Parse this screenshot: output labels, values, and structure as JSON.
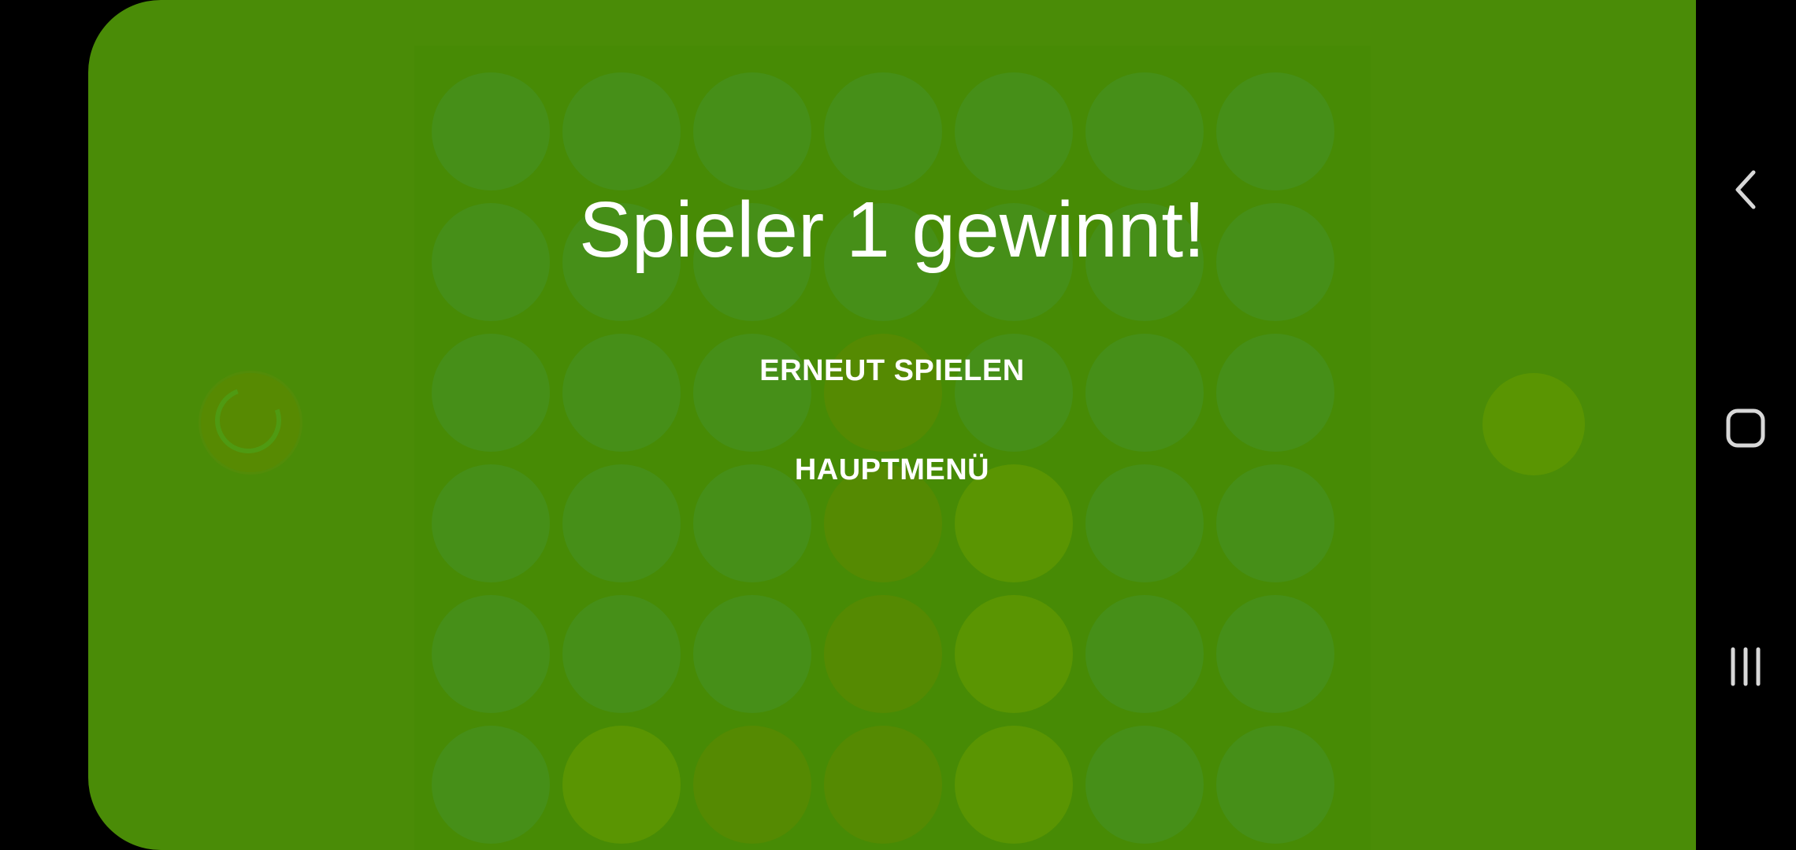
{
  "dialog": {
    "title": "Spieler 1 gewinnt!",
    "play_again_label": "ERNEUT SPIELEN",
    "main_menu_label": "HAUPTMENÜ"
  },
  "board": {
    "columns": 7,
    "rows": 6,
    "cells": [
      [
        "empty",
        "empty",
        "empty",
        "empty",
        "empty",
        "empty",
        "empty"
      ],
      [
        "empty",
        "empty",
        "empty",
        "empty",
        "empty",
        "empty",
        "empty"
      ],
      [
        "empty",
        "empty",
        "empty",
        "p1",
        "empty",
        "empty",
        "empty"
      ],
      [
        "empty",
        "empty",
        "empty",
        "p1",
        "p2",
        "empty",
        "empty"
      ],
      [
        "empty",
        "empty",
        "empty",
        "p1",
        "p2",
        "empty",
        "empty"
      ],
      [
        "empty",
        "p2",
        "p1",
        "p1",
        "p2",
        "empty",
        "empty"
      ]
    ]
  },
  "players": {
    "player1_color": "#578a02",
    "player2_color": "#5a9502",
    "active": "player1"
  },
  "colors": {
    "background": "#4a8c07",
    "board": "#478b05",
    "empty_slot": "#468f18",
    "text": "#ffffff"
  },
  "navbar": {
    "icons": [
      "back-icon",
      "home-icon",
      "recents-icon"
    ]
  }
}
